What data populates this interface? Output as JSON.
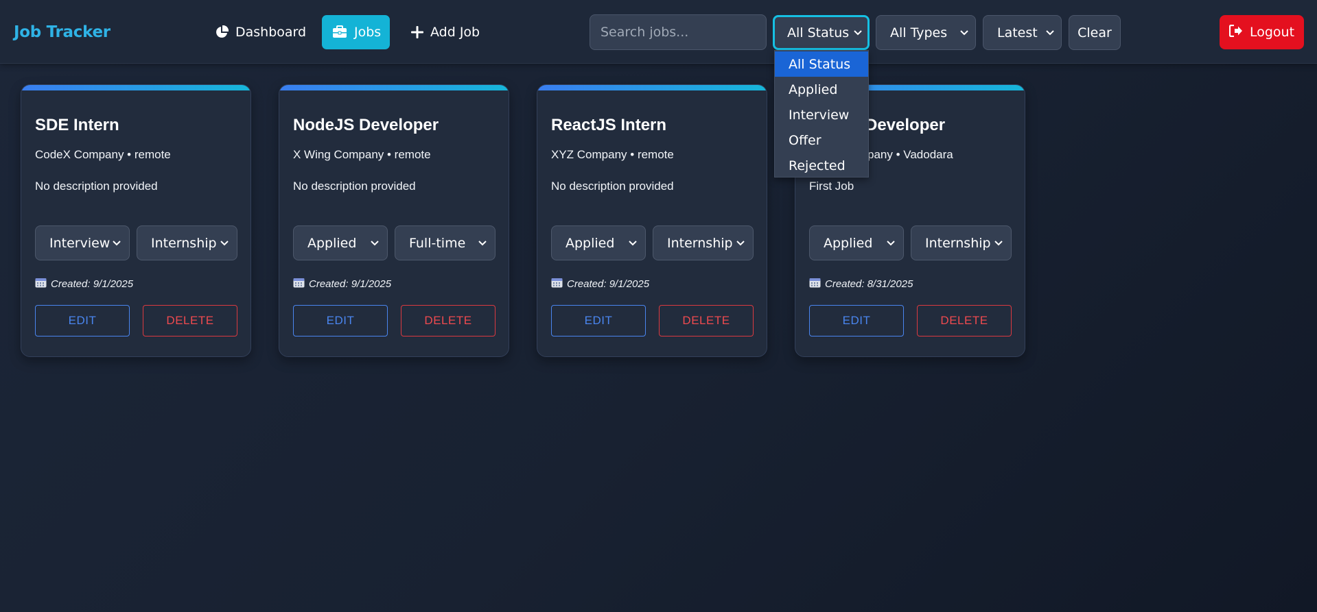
{
  "nav": {
    "brand": "Job Tracker",
    "links": [
      {
        "label": "Dashboard",
        "icon": "pie-chart-icon",
        "active": false
      },
      {
        "label": "Jobs",
        "icon": "briefcase-icon",
        "active": true
      },
      {
        "label": "Add Job",
        "icon": "plus-icon",
        "active": false
      }
    ],
    "search_placeholder": "Search jobs...",
    "status_filter": "All Status",
    "type_filter": "All Types",
    "sort_filter": "Latest",
    "clear_label": "Clear",
    "logout_label": "Logout"
  },
  "status_dropdown": {
    "options": [
      "All Status",
      "Applied",
      "Interview",
      "Offer",
      "Rejected"
    ],
    "selected": "All Status"
  },
  "jobs": [
    {
      "title": "SDE Intern",
      "meta": "CodeX Company • remote",
      "description": "No description provided",
      "status": "Interview",
      "type": "Internship",
      "created": "Created: 9/1/2025"
    },
    {
      "title": "NodeJS Developer",
      "meta": "X Wing Company • remote",
      "description": "No description provided",
      "status": "Applied",
      "type": "Full-time",
      "created": "Created: 9/1/2025"
    },
    {
      "title": "ReactJS Intern",
      "meta": "XYZ Company • remote",
      "description": "No description provided",
      "status": "Applied",
      "type": "Internship",
      "created": "Created: 9/1/2025"
    },
    {
      "title": "Developer",
      "meta": "pany • Vadodara",
      "description": "First Job",
      "status": "Applied",
      "type": "Internship",
      "created": "Created: 8/31/2025"
    }
  ],
  "card_actions": {
    "edit": "EDIT",
    "delete": "DELETE"
  },
  "colors": {
    "brand": "#2fb3e6",
    "active_nav": "#14b3d6",
    "logout": "#e4101f",
    "edit": "#4a86f0",
    "delete": "#ef4a4f",
    "dropdown_selected": "#1a65d6"
  }
}
